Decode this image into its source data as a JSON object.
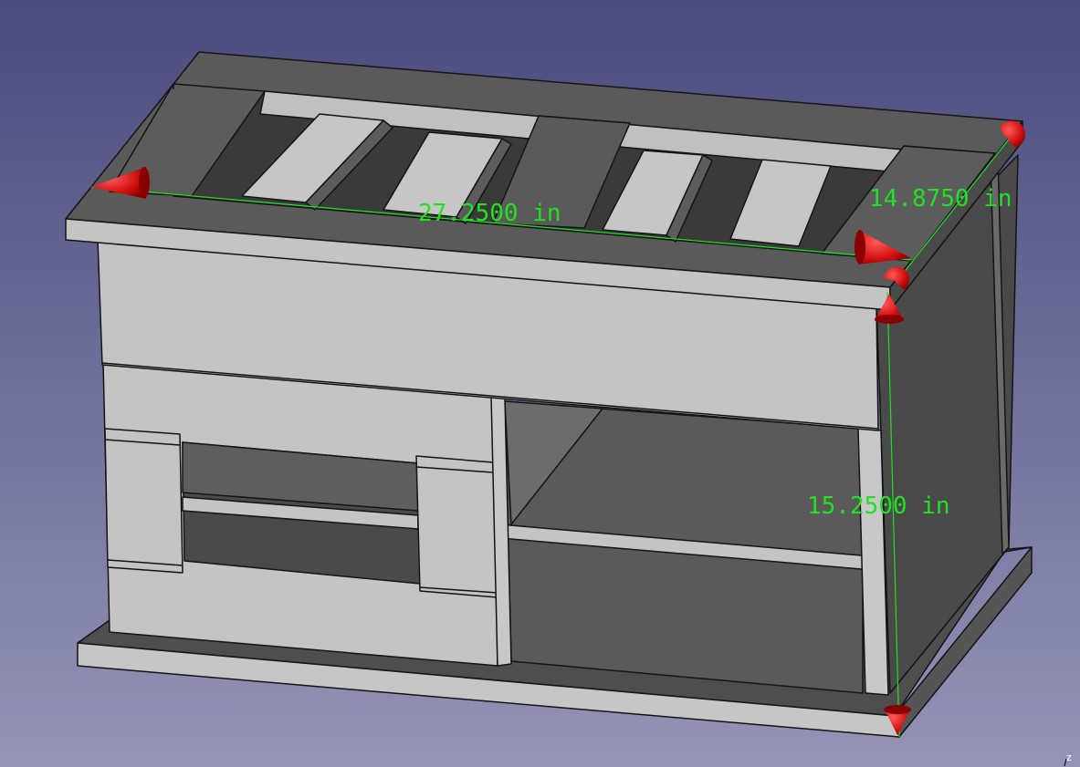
{
  "view": {
    "background_top": "#4a4b7e",
    "background_bottom": "#9494b6",
    "model_face_light": "#c4c4c4",
    "model_face_dark": "#5a5a5a",
    "edge_color": "#141414"
  },
  "dimensions": {
    "color": "#22e022",
    "arrow_color": "#d41010",
    "length": "27.2500 in",
    "depth": "14.8750 in",
    "height": "15.2500 in"
  },
  "axis_cross": {
    "label": "z"
  }
}
